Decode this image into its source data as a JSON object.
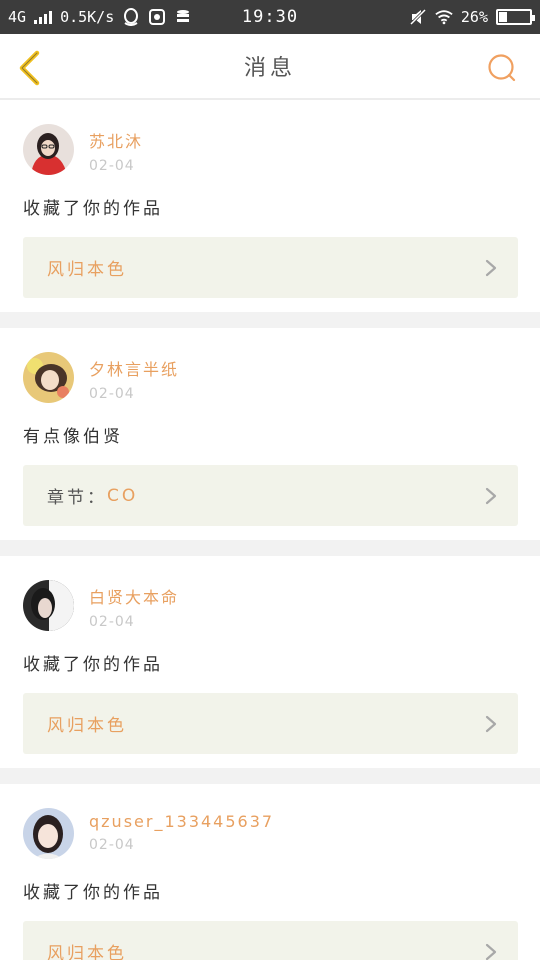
{
  "status_bar": {
    "network": "4G",
    "speed": "0.5K/s",
    "time": "19:30",
    "battery_text": "26%",
    "battery_level": 0.26
  },
  "header": {
    "title": "消息",
    "back_icon": "chevron-left-icon",
    "search_icon": "search-icon",
    "accent_color": "#f0c020",
    "search_color": "#f0a060"
  },
  "messages": [
    {
      "username": "苏北沐",
      "date": "02-04",
      "text": "收藏了你的作品",
      "ref_label": "",
      "ref_value": "风归本色"
    },
    {
      "username": "夕林言半纸",
      "date": "02-04",
      "text": "有点像伯贤",
      "ref_label": "章节：",
      "ref_value": "CO"
    },
    {
      "username": "白贤大本命",
      "date": "02-04",
      "text": "收藏了你的作品",
      "ref_label": "",
      "ref_value": "风归本色"
    },
    {
      "username": "qzuser_133445637",
      "date": "02-04",
      "text": "收藏了你的作品",
      "ref_label": "",
      "ref_value": "风归本色"
    }
  ]
}
